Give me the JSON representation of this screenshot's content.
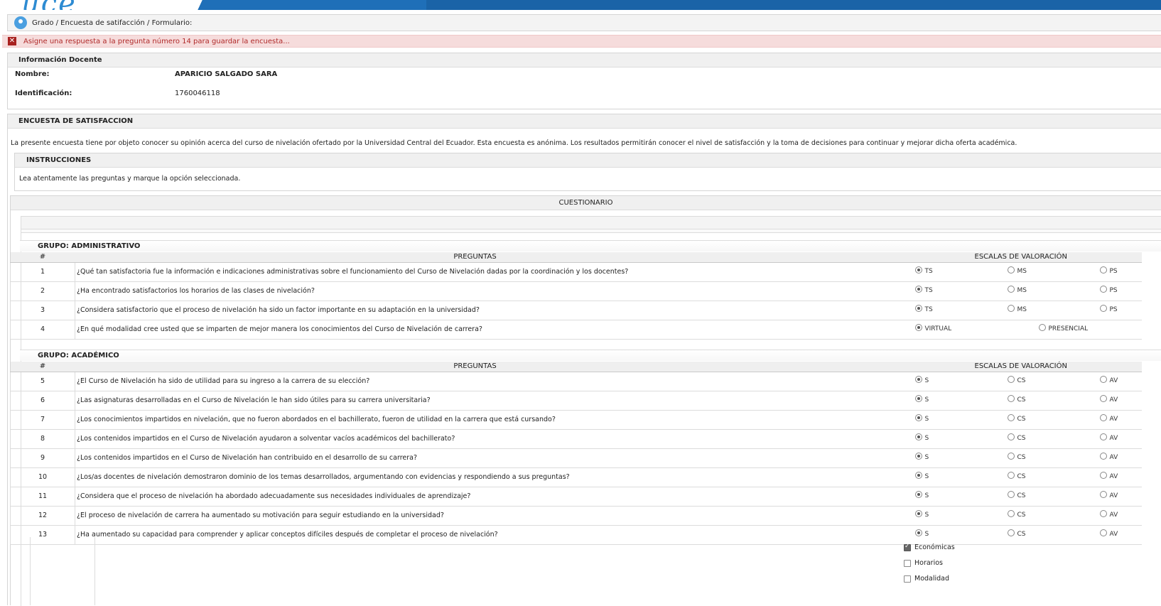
{
  "breadcrumb": "Grado / Encuesta de satifacción / Formulario:",
  "alert": "Asigne una respuesta a la pregunta número 14 para guardar la encuesta...",
  "docente": {
    "title": "Información Docente",
    "nombre_label": "Nombre:",
    "nombre_value": "APARICIO SALGADO SARA",
    "id_label": "Identificación:",
    "id_value": "1760046118"
  },
  "encuesta": {
    "title": "ENCUESTA DE SATISFACCION",
    "description": "La presente encuesta tiene por objeto conocer su opinión acerca del curso de nivelación ofertado por la Universidad Central del Ecuador. Esta encuesta es anónima. Los resultados permitirán conocer el nivel de satisfacción y la toma de decisiones para continuar y mejorar dicha oferta académica.",
    "instr_title": "INSTRUCCIONES",
    "instr_text": "Lea atentamente las preguntas y marque la opción seleccionada."
  },
  "cuestionario": "CUESTIONARIO",
  "headers": {
    "num": "#",
    "preguntas": "PREGUNTAS",
    "escalas": "ESCALAS DE VALORACIÓN"
  },
  "group_admin": {
    "title": "GRUPO: ADMINISTRATIVO",
    "rows": [
      {
        "n": "1",
        "q": "¿Qué tan satisfactoria fue la información e indicaciones administrativas sobre el funcionamiento del Curso de Nivelación dadas por la coordinación y los docentes?",
        "opts": [
          "TS",
          "MS",
          "PS"
        ],
        "sel": 0
      },
      {
        "n": "2",
        "q": "¿Ha encontrado satisfactorios los horarios de las clases de nivelación?",
        "opts": [
          "TS",
          "MS",
          "PS"
        ],
        "sel": 0
      },
      {
        "n": "3",
        "q": "¿Considera satisfactorio que el proceso de nivelación ha sido un factor importante en su adaptación en la universidad?",
        "opts": [
          "TS",
          "MS",
          "PS"
        ],
        "sel": 0
      },
      {
        "n": "4",
        "q": "¿En qué modalidad cree usted que se imparten de mejor manera los conocimientos del Curso de Nivelación de carrera?",
        "opts": [
          "VIRTUAL",
          "PRESENCIAL"
        ],
        "sel": 0
      }
    ]
  },
  "group_acad": {
    "title": "GRUPO: ACADÉMICO",
    "rows": [
      {
        "n": "5",
        "q": "¿El Curso de Nivelación ha sido de utilidad para su ingreso a la carrera de su elección?",
        "opts": [
          "S",
          "CS",
          "AV"
        ],
        "sel": 0
      },
      {
        "n": "6",
        "q": "¿Las asignaturas desarrolladas en el Curso de Nivelación le han sido útiles para su carrera universitaria?",
        "opts": [
          "S",
          "CS",
          "AV"
        ],
        "sel": 0
      },
      {
        "n": "7",
        "q": "¿Los conocimientos impartidos en nivelación, que no fueron abordados en el bachillerato, fueron de utilidad en la carrera que está cursando?",
        "opts": [
          "S",
          "CS",
          "AV"
        ],
        "sel": 0
      },
      {
        "n": "8",
        "q": "¿Los contenidos impartidos en el Curso de Nivelación ayudaron a solventar vacíos académicos del bachillerato?",
        "opts": [
          "S",
          "CS",
          "AV"
        ],
        "sel": 0
      },
      {
        "n": "9",
        "q": "¿Los contenidos impartidos en el Curso de Nivelación han contribuido en el desarrollo de su carrera?",
        "opts": [
          "S",
          "CS",
          "AV"
        ],
        "sel": 0
      },
      {
        "n": "10",
        "q": "¿Los/as docentes de nivelación demostraron dominio de los temas desarrollados, argumentando con evidencias y respondiendo a sus preguntas?",
        "opts": [
          "S",
          "CS",
          "AV"
        ],
        "sel": 0
      },
      {
        "n": "11",
        "q": "¿Considera que el proceso de nivelación ha abordado adecuadamente sus necesidades individuales de aprendizaje?",
        "opts": [
          "S",
          "CS",
          "AV"
        ],
        "sel": 0
      },
      {
        "n": "12",
        "q": "¿El proceso de nivelación de carrera ha aumentado su motivación para seguir estudiando en la universidad?",
        "opts": [
          "S",
          "CS",
          "AV"
        ],
        "sel": 0
      },
      {
        "n": "13",
        "q": "¿Ha aumentado su capacidad para comprender y aplicar conceptos difíciles después de completar el proceso de nivelación?",
        "opts": [
          "S",
          "CS",
          "AV"
        ],
        "sel": 0
      }
    ]
  },
  "checkboxes": [
    {
      "label": "Económicas",
      "checked": true
    },
    {
      "label": "Horarios",
      "checked": false
    },
    {
      "label": "Modalidad",
      "checked": false
    }
  ]
}
